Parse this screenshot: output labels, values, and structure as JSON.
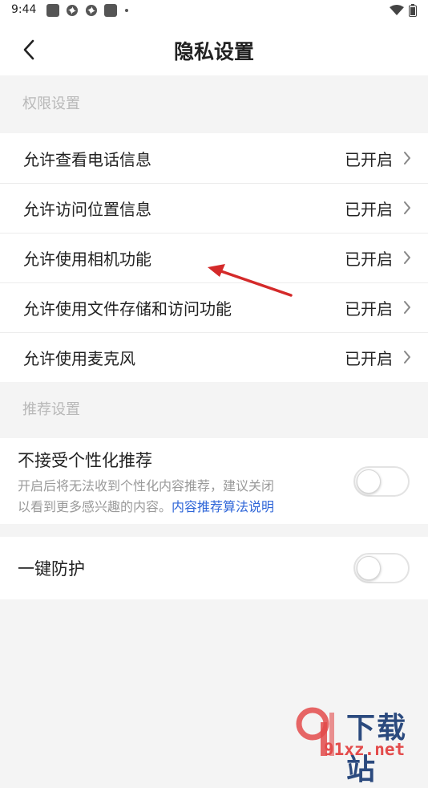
{
  "status_bar": {
    "time": "9:44"
  },
  "header": {
    "title": "隐私设置"
  },
  "sections": {
    "permissions": {
      "header": "权限设置",
      "items": [
        {
          "label": "允许查看电话信息",
          "status": "已开启"
        },
        {
          "label": "允许访问位置信息",
          "status": "已开启"
        },
        {
          "label": "允许使用相机功能",
          "status": "已开启"
        },
        {
          "label": "允许使用文件存储和访问功能",
          "status": "已开启"
        },
        {
          "label": "允许使用麦克风",
          "status": "已开启"
        }
      ]
    },
    "recommend": {
      "header": "推荐设置",
      "personalized": {
        "title": "不接受个性化推荐",
        "desc_line1": "开启后将无法收到个性化内容推荐，建议关闭",
        "desc_line2": "以看到更多感兴趣的内容。",
        "link": "内容推荐算法说明",
        "enabled": false
      }
    },
    "protection": {
      "title": "一键防护",
      "enabled": false
    }
  },
  "watermark": {
    "brand": "下载站",
    "url": "91xz.net"
  },
  "colors": {
    "link": "#2f66d8",
    "annotation_arrow": "#d42a2a",
    "background": "#f4f4f4"
  }
}
